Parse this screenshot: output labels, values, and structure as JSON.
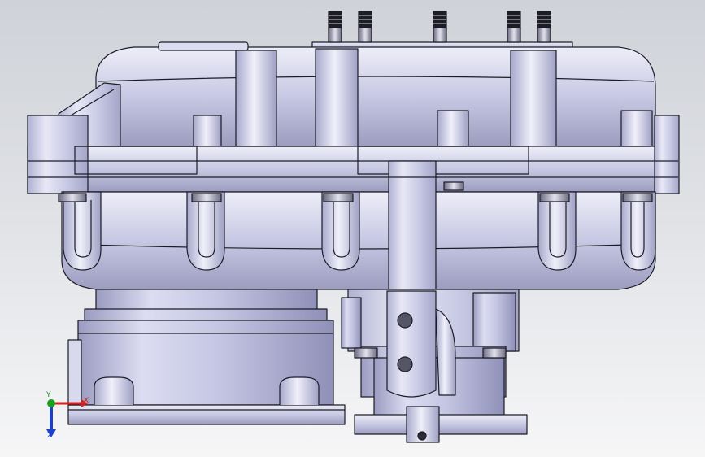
{
  "viewport": {
    "name": "cad-graphics-area",
    "background_top": "#cfd2d8",
    "background_bottom": "#f6f6f7"
  },
  "model": {
    "body_color": "#c4c5e0",
    "edge_color": "#1c1c26"
  },
  "triad": {
    "x_label": "X",
    "y_label": "Y",
    "z_label": "Z",
    "x_color": "#d32222",
    "y_color": "#1aa01a",
    "z_color": "#1f3fc9"
  }
}
